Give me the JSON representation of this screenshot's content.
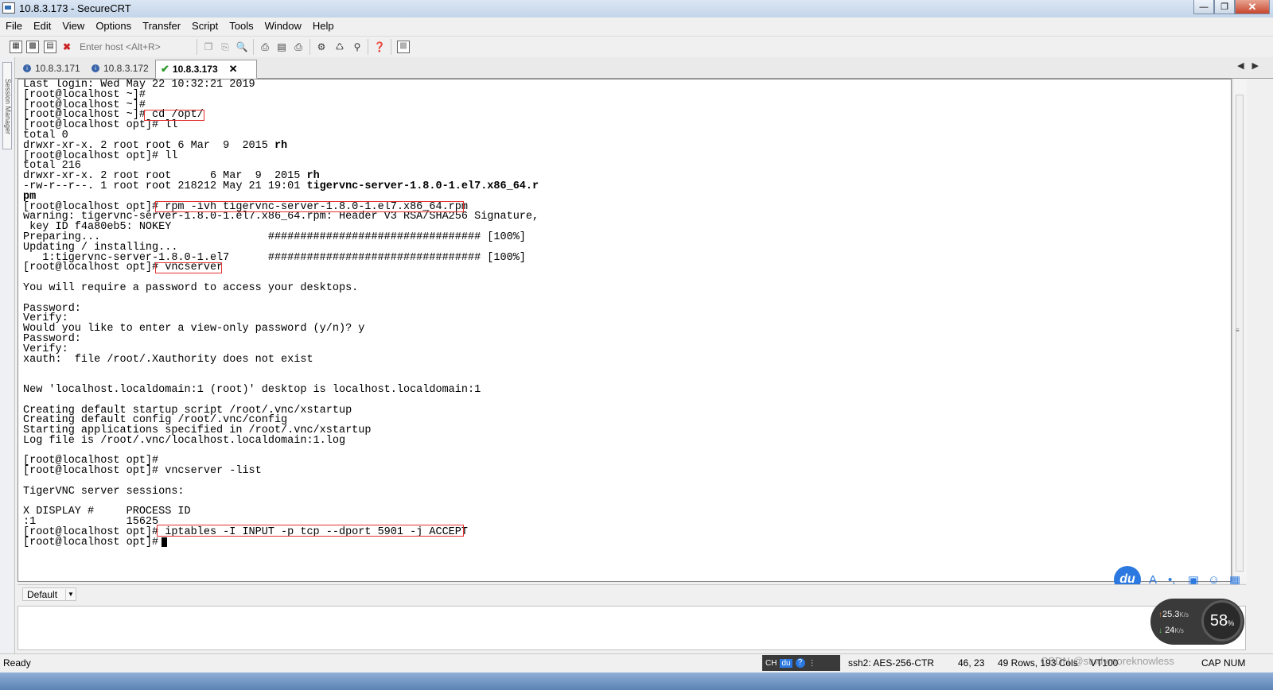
{
  "window": {
    "title": "10.8.3.173 - SecureCRT"
  },
  "menu": [
    "File",
    "Edit",
    "View",
    "Options",
    "Transfer",
    "Script",
    "Tools",
    "Window",
    "Help"
  ],
  "toolbar": {
    "host_placeholder": "Enter host <Alt+R>"
  },
  "session_manager": {
    "label": "Session Manager"
  },
  "tabs": [
    {
      "label": "10.8.3.171"
    },
    {
      "label": "10.8.3.172"
    },
    {
      "label": "10.8.3.173"
    }
  ],
  "terminal": {
    "lines": [
      "Last login: Wed May 22 10:32:21 2019",
      "[root@localhost ~]#",
      "[root@localhost ~]#",
      "[root@localhost ~]# cd /opt/",
      "[root@localhost opt]# ll",
      "total 0",
      "drwxr-xr-x. 2 root root 6 Mar  9  2015 rh",
      "[root@localhost opt]# ll",
      "total 216",
      "drwxr-xr-x. 2 root root      6 Mar  9  2015 rh",
      "-rw-r--r--. 1 root root 218212 May 21 19:01 tigervnc-server-1.8.0-1.el7.x86_64.r",
      "pm",
      "[root@localhost opt]# rpm -ivh tigervnc-server-1.8.0-1.el7.x86_64.rpm",
      "warning: tigervnc-server-1.8.0-1.el7.x86_64.rpm: Header V3 RSA/SHA256 Signature,",
      " key ID f4a80eb5: NOKEY",
      "Preparing...                          ################################# [100%]",
      "Updating / installing...",
      "   1:tigervnc-server-1.8.0-1.el7      ################################# [100%]",
      "[root@localhost opt]# vncserver",
      "",
      "You will require a password to access your desktops.",
      "",
      "Password:",
      "Verify:",
      "Would you like to enter a view-only password (y/n)? y",
      "Password:",
      "Verify:",
      "xauth:  file /root/.Xauthority does not exist",
      "",
      "",
      "New 'localhost.localdomain:1 (root)' desktop is localhost.localdomain:1",
      "",
      "Creating default startup script /root/.vnc/xstartup",
      "Creating default config /root/.vnc/config",
      "Starting applications specified in /root/.vnc/xstartup",
      "Log file is /root/.vnc/localhost.localdomain:1.log",
      "",
      "[root@localhost opt]#",
      "[root@localhost opt]# vncserver -list",
      "",
      "TigerVNC server sessions:",
      "",
      "X DISPLAY #     PROCESS ID",
      ":1              15625",
      "[root@localhost opt]# iptables -I INPUT -p tcp --dport 5901 -j ACCEPT",
      "[root@localhost opt]# "
    ],
    "bold_ranges": [
      {
        "line": 6,
        "text": "rh"
      },
      {
        "line": 9,
        "text": "rh"
      },
      {
        "line": 10,
        "text": "tigervnc-server-1.8.0-1.el7.x86_64.r"
      },
      {
        "line": 11,
        "text": "pm"
      }
    ]
  },
  "ime_toolbar": {
    "logo": "du"
  },
  "command_bar": {
    "selected": "Default"
  },
  "netmon": {
    "upload": "25.3",
    "upload_unit": "K/s",
    "download": "24",
    "download_unit": "K/s",
    "percent": "58",
    "percent_unit": "%"
  },
  "status": {
    "ready": "Ready",
    "ime_lang": "CH",
    "ime_logo": "du",
    "cipher": "ssh2: AES-256-CTR",
    "cursor_pos": "46,  23",
    "size": "49 Rows, 193 Cols",
    "terminal_type": "VT100",
    "caps": "CAP",
    "num": "NUM"
  },
  "watermark": "CSDN @studymoreknowless"
}
